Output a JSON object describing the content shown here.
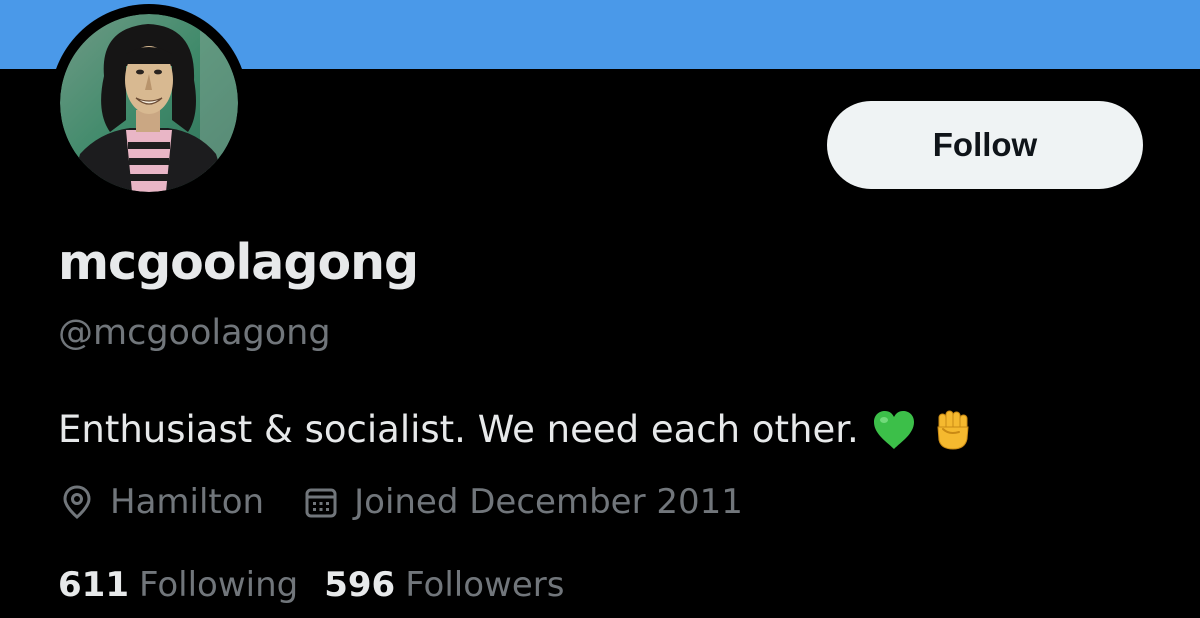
{
  "profile": {
    "display_name": "mcgoolagong",
    "handle": "@mcgoolagong",
    "bio": "Enthusiast & socialist. We need each other.",
    "bio_emojis": [
      "green-heart",
      "raised-fist"
    ],
    "location": "Hamilton",
    "joined": "Joined December 2011"
  },
  "actions": {
    "follow_label": "Follow"
  },
  "stats": {
    "following_count": "611",
    "following_label": "Following",
    "followers_count": "596",
    "followers_label": "Followers"
  },
  "icons": {
    "location": "location-pin-icon",
    "joined": "calendar-icon"
  },
  "colors": {
    "banner": "#4a99e9",
    "background": "#000000",
    "primary_text": "#e7e9ea",
    "secondary_text": "#71767b",
    "follow_button_bg": "#eff3f4"
  }
}
